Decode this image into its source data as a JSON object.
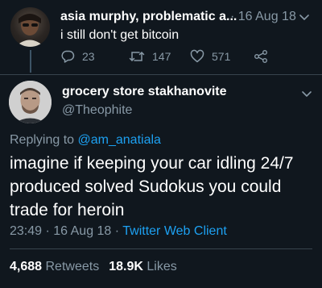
{
  "parent_tweet": {
    "display_name": "asia murphy, problematic a...",
    "date": "· 16 Aug 18",
    "text": "i still don't get bitcoin",
    "replies": "23",
    "retweets": "147",
    "likes": "571"
  },
  "main_tweet": {
    "display_name": "grocery store stakhanovite",
    "handle": "@Theophite",
    "replying_prefix": "Replying to",
    "replying_to": "@am_anatiala",
    "text": "imagine if keeping your car idling 24/7 produced solved Sudokus you could trade for heroin",
    "time_date": "23:49 · 16 Aug 18 ·",
    "client": "Twitter Web Client",
    "retweet_count": "4,688",
    "retweet_label": "Retweets",
    "like_count": "18.9K",
    "like_label": "Likes"
  },
  "colors": {
    "background": "#10171e",
    "text_primary": "#ffffff",
    "text_secondary": "#8899a6",
    "link": "#1da1f2",
    "divider": "#38444d"
  }
}
